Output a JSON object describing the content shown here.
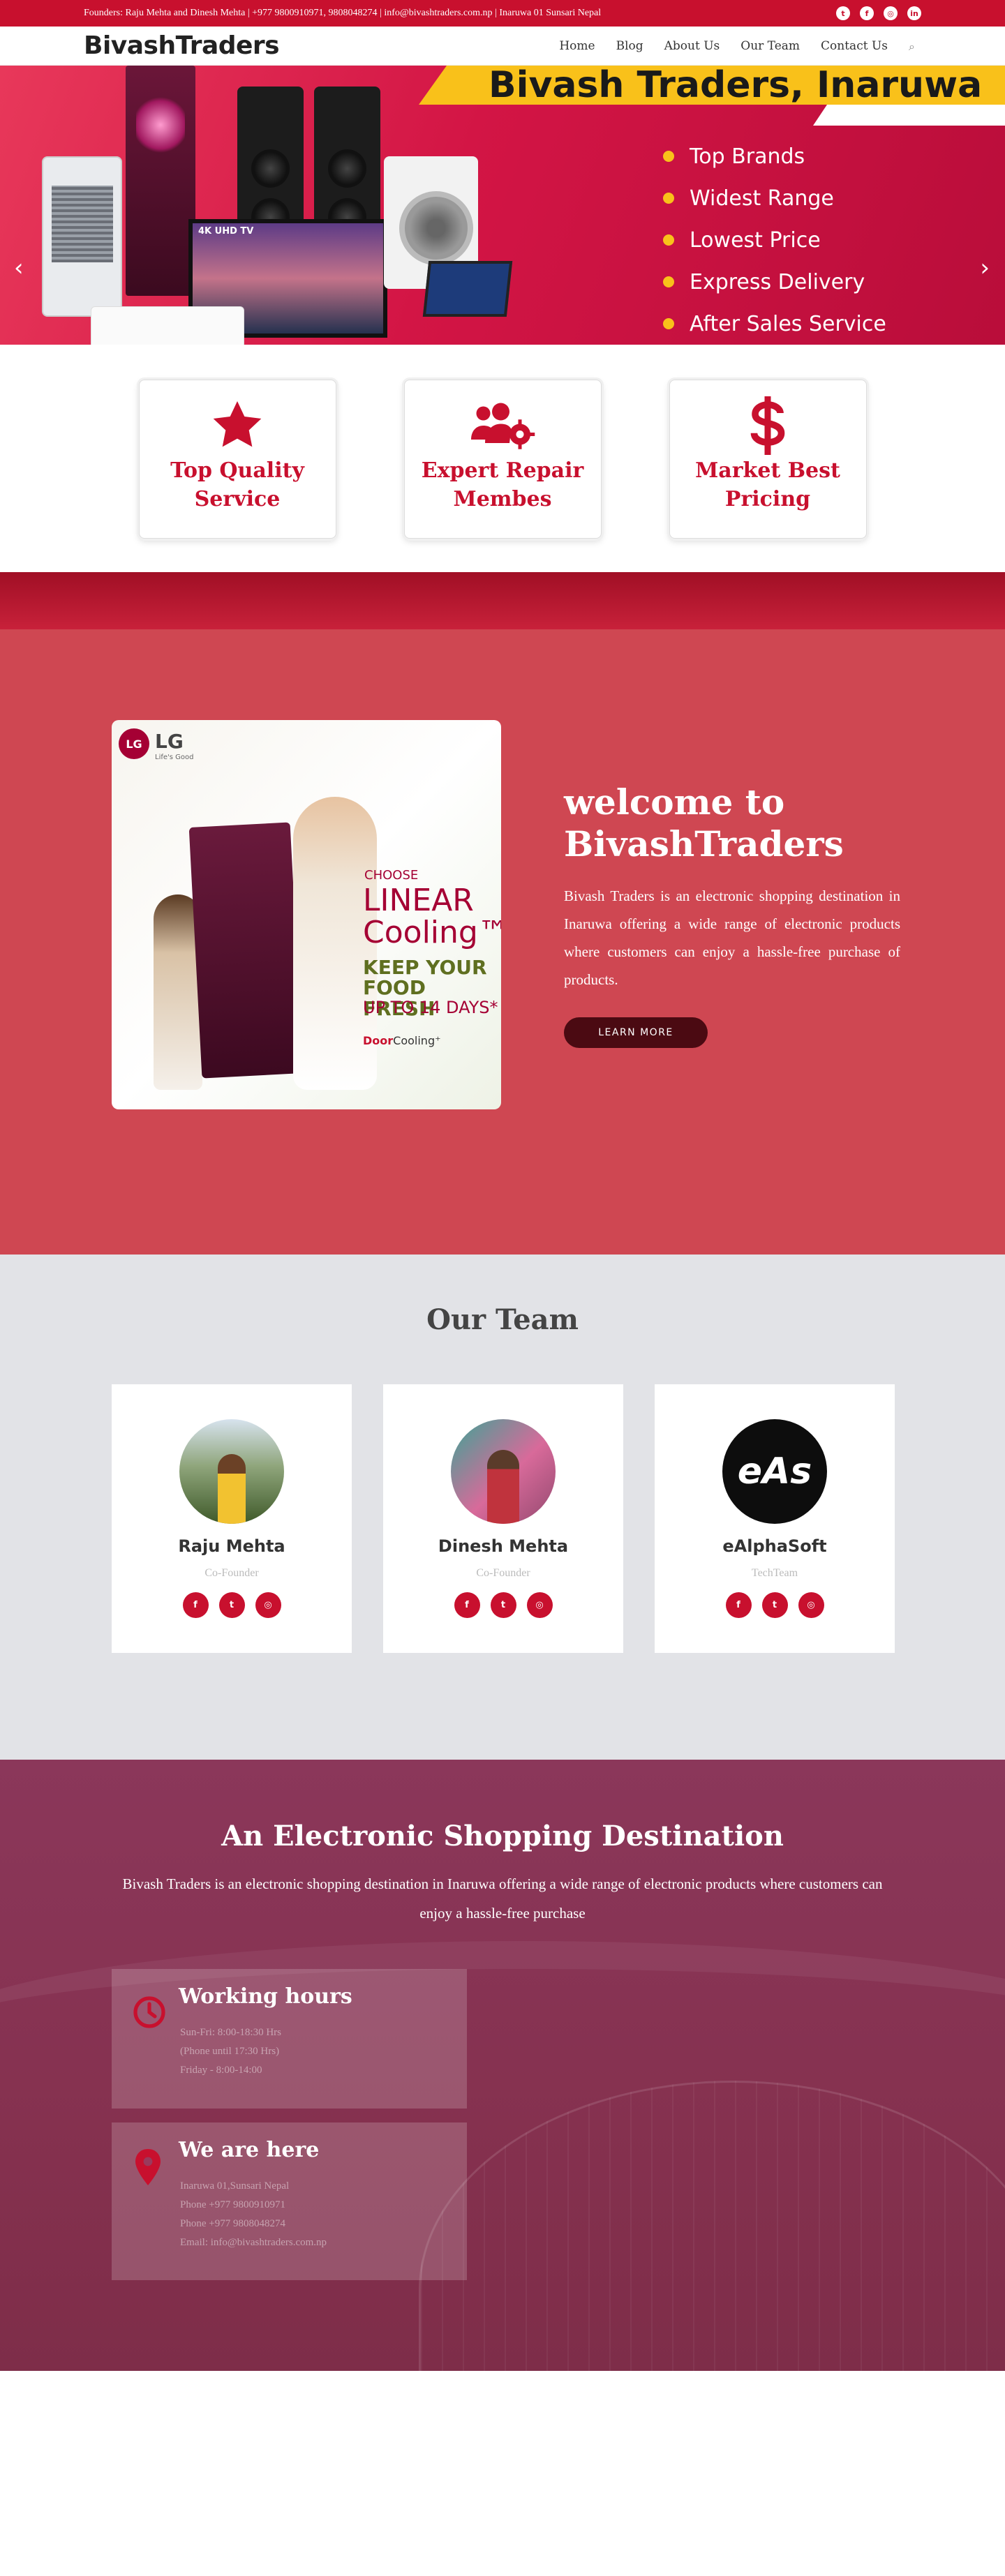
{
  "topbar": {
    "info": "Founders: Raju Mehta and Dinesh Mehta | +977 9800910971, 9808048274 | info@bivashtraders.com.np | Inaruwa 01 Sunsari Nepal",
    "social": [
      "twitter-icon",
      "facebook-icon",
      "instagram-icon",
      "linkedin-icon"
    ]
  },
  "header": {
    "logo": "BivashTraders",
    "nav": [
      "Home",
      "Blog",
      "About Us",
      "Our Team",
      "Contact Us"
    ]
  },
  "hero": {
    "banner_title": "Bivash Traders, Inaruwa",
    "features": [
      "Top Brands",
      "Widest Range",
      "Lowest Price",
      "Express Delivery",
      "After Sales Service"
    ],
    "tv_label": "4K UHD TV",
    "prev_arrow": "‹",
    "next_arrow": "›"
  },
  "feature_cards": [
    {
      "icon": "star-icon",
      "title": "Top Quality Service"
    },
    {
      "icon": "users-gear-icon",
      "title": "Expert Repair Membes"
    },
    {
      "icon": "dollar-icon",
      "title": "Market Best Pricing"
    }
  ],
  "welcome": {
    "title": "welcome to BivashTraders",
    "description": "Bivash Traders is an electronic shopping destination in Inaruwa offering a wide range of electronic products where customers can enjoy a hassle-free purchase of products.",
    "button": "LEARN MORE",
    "poster": {
      "logo": "LG",
      "brand": "LG",
      "tagline": "Life's Good",
      "choose": "CHOOSE",
      "linear": "LINEAR Cooling™",
      "keep": "KEEP YOUR FOOD FRESH",
      "upto": "UP TO 14 DAYS*",
      "door_a": "Door",
      "door_b": "Cooling⁺"
    }
  },
  "team": {
    "title": "Our Team",
    "members": [
      {
        "name": "Raju Mehta",
        "role": "Co-Founder",
        "photo": "raju"
      },
      {
        "name": "Dinesh Mehta",
        "role": "Co-Founder",
        "photo": "dinesh"
      },
      {
        "name": "eAlphaSoft",
        "role": "TechTeam",
        "photo": "eas",
        "logo_text": "eAs"
      }
    ],
    "social_icons": [
      "facebook-icon",
      "twitter-icon",
      "instagram-icon"
    ],
    "social_glyphs": [
      "f",
      "t",
      "◎"
    ]
  },
  "destination": {
    "title": "An Electronic Shopping Destination",
    "description": "Bivash Traders is an electronic shopping destination in Inaruwa offering a wide range of electronic products where customers can enjoy a hassle-free purchase",
    "hours": {
      "title": "Working hours",
      "lines": [
        "Sun-Fri: 8:00-18:30 Hrs",
        "(Phone until 17:30 Hrs)",
        "Friday - 8:00-14:00"
      ]
    },
    "here": {
      "title": "We are here",
      "lines": [
        "Inaruwa 01,Sunsari Nepal",
        "Phone +977 9800910971",
        "Phone +977 9808048274",
        "Email: info@bivashtraders.com.np"
      ]
    }
  },
  "colors": {
    "brand_red": "#c8102e",
    "welcome_bg": "#cf4752",
    "team_bg": "#e2e3e7",
    "destination_bg": "#8b375a"
  }
}
